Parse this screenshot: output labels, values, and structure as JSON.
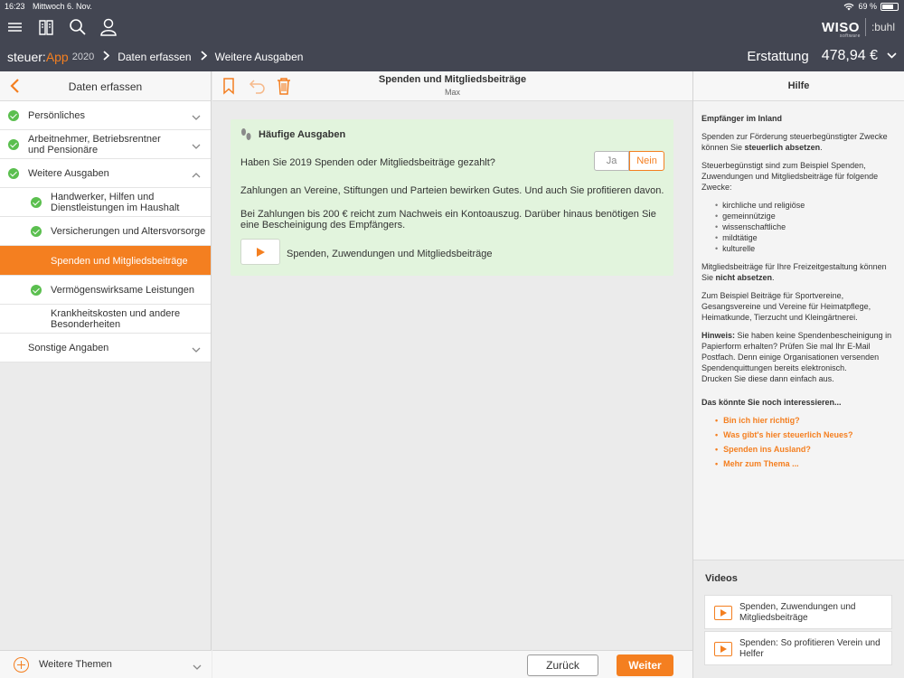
{
  "status": {
    "time": "16:23",
    "date": "Mittwoch 6. Nov.",
    "battery": "69 %"
  },
  "header": {
    "brand_steuer": "steuer:",
    "brand_app": "App",
    "year": "2020",
    "crumb1": "Daten erfassen",
    "crumb2": "Weitere Ausgaben",
    "refund_label": "Erstattung",
    "refund_amount": "478,94 €",
    "wiso": "WISO",
    "wiso_sub": "software",
    "buhl": ":buhl"
  },
  "sidebar": {
    "title": "Daten erfassen",
    "items": [
      {
        "label": "Persönliches"
      },
      {
        "label": "Arbeitnehmer, Betriebsrentner und Pensionäre"
      },
      {
        "label": "Weitere Ausgaben"
      },
      {
        "label": "Handwerker, Hilfen und Dienstleistungen im Haushalt"
      },
      {
        "label": "Versicherungen und Altersvorsorge"
      },
      {
        "label": "Spenden und Mitgliedsbeiträge"
      },
      {
        "label": "Vermögenswirksame Leistungen"
      },
      {
        "label": "Krankheitskosten und andere Besonderheiten"
      },
      {
        "label": "Sonstige Angaben"
      }
    ],
    "footer_label": "Weitere Themen"
  },
  "main": {
    "title": "Spenden und Mitgliedsbeiträge",
    "subtitle": "Max",
    "card": {
      "title": "Häufige Ausgaben",
      "question": "Haben Sie 2019 Spenden oder Mitgliedsbeiträge gezahlt?",
      "yes": "Ja",
      "no": "Nein",
      "selected": "Nein",
      "p1": "Zahlungen an Vereine, Stiftungen und Parteien bewirken Gutes. Und auch Sie profitieren davon.",
      "p2": "Bei Zahlungen bis 200 € reicht zum Nachweis ein Kontoauszug. Darüber hinaus benötigen Sie eine Bescheinigung des Empfängers.",
      "video_label": "Spenden, Zuwendungen und Mitgliedsbeiträge"
    },
    "back_label": "Zurück",
    "next_label": "Weiter"
  },
  "help": {
    "title": "Hilfe",
    "heading": "Empfänger im Inland",
    "p1_pre": "Spenden zur Förderung steuerbegünstigter Zwecke können Sie ",
    "p1_bold": "steuerlich absetzen",
    "p1_post": ".",
    "p2": "Steuerbegünstigt sind zum Beispiel Spenden, Zuwendungen und Mitgliedsbeiträge für folgende Zwecke:",
    "purposes": [
      "kirchliche und religiöse",
      "gemeinnützige",
      "wissenschaftliche",
      "mildtätige",
      "kulturelle"
    ],
    "p3_pre": "Mitgliedsbeiträge für Ihre Freizeitgestaltung können Sie ",
    "p3_bold": "nicht absetzen",
    "p3_post": ".",
    "p4": "Zum Beispiel Beiträge für Sportvereine, Gesangsvereine und Vereine für Heimatpflege, Heimatkunde, Tierzucht und Kleingärtnerei.",
    "hint_label": "Hinweis:",
    "hint_text": " Sie haben keine Spendenbescheinigung in Papierform erhalten? Prüfen Sie mal Ihr E-Mail Postfach. Denn einige Organisationen versenden Spendenquittungen bereits elektronisch.",
    "hint_text2": "Drucken Sie diese dann einfach aus.",
    "more_heading": "Das könnte Sie noch interessieren...",
    "links": [
      "Bin ich hier richtig?",
      "Was gibt's hier steuerlich Neues?",
      "Spenden ins Ausland?",
      "Mehr zum Thema ..."
    ],
    "videos_title": "Videos",
    "videos": [
      "Spenden, Zuwendungen und Mitgliedsbeiträge",
      "Spenden: So profitieren Verein und Helfer"
    ]
  },
  "colors": {
    "accent": "#f47f20",
    "header": "#434652",
    "check": "#5bbf4f",
    "card": "#e2f4dd"
  }
}
